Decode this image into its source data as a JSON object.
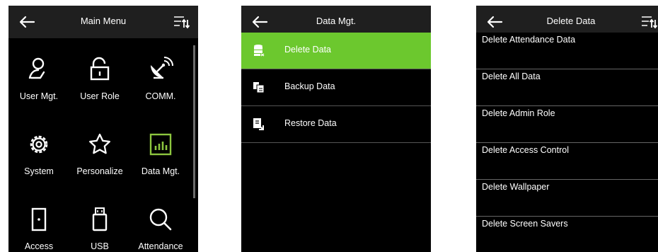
{
  "colors": {
    "screen_bg": "#000000",
    "title_bar": "#1f1f1f",
    "accent_green": "#6cc82e",
    "divider": "#555555",
    "text": "#ffffff"
  },
  "main_menu": {
    "title": "Main Menu",
    "items": [
      {
        "label": "User Mgt.",
        "icon": "user-icon"
      },
      {
        "label": "User Role",
        "icon": "lock-icon"
      },
      {
        "label": "COMM.",
        "icon": "satellite-dish-icon"
      },
      {
        "label": "System",
        "icon": "gear-icon"
      },
      {
        "label": "Personalize",
        "icon": "star-icon"
      },
      {
        "label": "Data Mgt.",
        "icon": "bar-chart-icon"
      },
      {
        "label": "Access",
        "icon": "door-icon"
      },
      {
        "label": "USB",
        "icon": "usb-drive-icon"
      },
      {
        "label": "Attendance",
        "icon": "search-icon"
      }
    ]
  },
  "data_mgt": {
    "title": "Data Mgt.",
    "items": [
      {
        "label": "Delete Data",
        "icon": "database-delete-icon",
        "selected": true
      },
      {
        "label": "Backup Data",
        "icon": "backup-icon",
        "selected": false
      },
      {
        "label": "Restore Data",
        "icon": "restore-icon",
        "selected": false
      }
    ]
  },
  "delete_data": {
    "title": "Delete Data",
    "items": [
      {
        "label": "Delete Attendance Data"
      },
      {
        "label": "Delete All Data"
      },
      {
        "label": "Delete Admin Role"
      },
      {
        "label": "Delete Access Control"
      },
      {
        "label": "Delete Wallpaper"
      },
      {
        "label": "Delete Screen Savers"
      }
    ]
  }
}
